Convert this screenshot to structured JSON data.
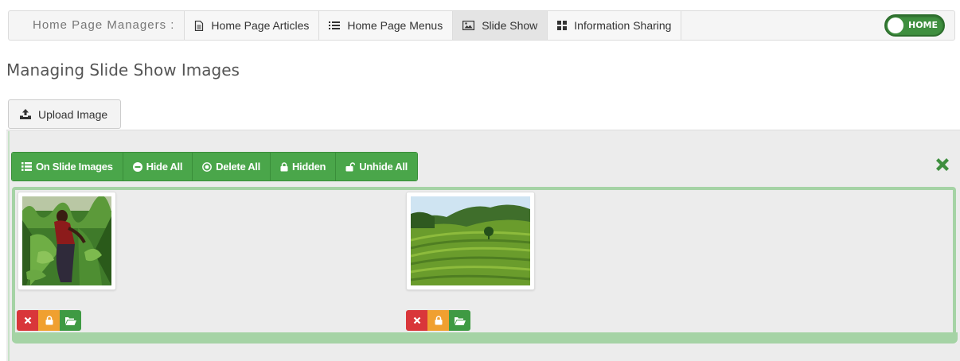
{
  "topbar": {
    "label": "Home Page Managers :",
    "tabs": [
      {
        "label": "Home Page Articles",
        "icon": "file-icon"
      },
      {
        "label": "Home Page Menus",
        "icon": "list-icon"
      },
      {
        "label": "Slide Show",
        "icon": "picture-icon",
        "active": true
      },
      {
        "label": "Information Sharing",
        "icon": "grid-icon"
      }
    ],
    "home_toggle": "HOME"
  },
  "page_title": "Managing Slide Show Images",
  "upload_label": "Upload Image",
  "toolbar": {
    "buttons": [
      {
        "label": "On Slide Images",
        "icon": "list-icon"
      },
      {
        "label": "Hide All",
        "icon": "minus-circle-icon"
      },
      {
        "label": "Delete All",
        "icon": "remove-circle-icon"
      },
      {
        "label": "Hidden",
        "icon": "lock-icon"
      },
      {
        "label": "Unhide All",
        "icon": "unlock-icon"
      }
    ]
  },
  "images": [
    {
      "name": "slide-image-1",
      "actions": [
        "delete",
        "hide",
        "open"
      ]
    },
    {
      "name": "slide-image-2",
      "actions": [
        "delete",
        "hide",
        "open"
      ]
    }
  ],
  "colors": {
    "accent_green": "#4aa64a",
    "danger": "#d9363a",
    "warning": "#f0a030",
    "gallery_border": "#a5d3a5"
  }
}
